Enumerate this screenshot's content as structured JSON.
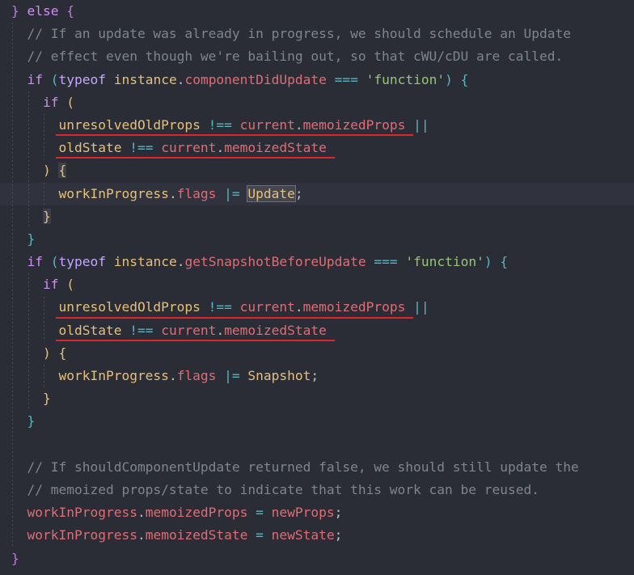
{
  "editor": {
    "lines": [
      [
        {
          "c": "br1",
          "t": "}"
        },
        {
          "c": "pl",
          "t": " "
        },
        {
          "c": "kw",
          "t": "else"
        },
        {
          "c": "pl",
          "t": " "
        },
        {
          "c": "br1",
          "t": "{"
        }
      ],
      [
        {
          "c": "pl",
          "t": "  "
        },
        {
          "c": "cm",
          "t": "// If an update was already in progress, we should schedule an Update"
        }
      ],
      [
        {
          "c": "pl",
          "t": "  "
        },
        {
          "c": "cm",
          "t": "// effect even though we're bailing out, so that cWU/cDU are called."
        }
      ],
      [
        {
          "c": "pl",
          "t": "  "
        },
        {
          "c": "kw",
          "t": "if"
        },
        {
          "c": "pl",
          "t": " "
        },
        {
          "c": "br2",
          "t": "("
        },
        {
          "c": "kw2",
          "t": "typeof"
        },
        {
          "c": "pl",
          "t": " "
        },
        {
          "c": "id",
          "t": "instance"
        },
        {
          "c": "pl",
          "t": "."
        },
        {
          "c": "fn",
          "t": "componentDidUpdate"
        },
        {
          "c": "pl",
          "t": " "
        },
        {
          "c": "op",
          "t": "==="
        },
        {
          "c": "pl",
          "t": " "
        },
        {
          "c": "str",
          "t": "'function'"
        },
        {
          "c": "br2",
          "t": ")"
        },
        {
          "c": "pl",
          "t": " "
        },
        {
          "c": "br2",
          "t": "{"
        }
      ],
      [
        {
          "c": "pl",
          "t": "    "
        },
        {
          "c": "kw",
          "t": "if"
        },
        {
          "c": "pl",
          "t": " "
        },
        {
          "c": "br3",
          "t": "("
        }
      ],
      [
        {
          "c": "pl",
          "t": "      "
        },
        {
          "c": "id",
          "t": "unresolvedOldProps"
        },
        {
          "c": "pl",
          "t": " "
        },
        {
          "c": "op",
          "t": "!=="
        },
        {
          "c": "pl",
          "t": " "
        },
        {
          "c": "fn",
          "t": "current"
        },
        {
          "c": "pl",
          "t": "."
        },
        {
          "c": "fn",
          "t": "memoizedProps"
        },
        {
          "c": "pl",
          "t": " "
        },
        {
          "c": "op",
          "t": "||"
        }
      ],
      [
        {
          "c": "pl",
          "t": "      "
        },
        {
          "c": "id",
          "t": "oldState"
        },
        {
          "c": "pl",
          "t": " "
        },
        {
          "c": "op",
          "t": "!=="
        },
        {
          "c": "pl",
          "t": " "
        },
        {
          "c": "fn",
          "t": "current"
        },
        {
          "c": "pl",
          "t": "."
        },
        {
          "c": "fn",
          "t": "memoizedState"
        }
      ],
      [
        {
          "c": "pl",
          "t": "    "
        },
        {
          "c": "br3",
          "t": ")"
        },
        {
          "c": "pl",
          "t": " "
        },
        {
          "c": "br3 sel",
          "t": "{"
        }
      ],
      [
        {
          "c": "pl",
          "t": "      "
        },
        {
          "c": "id",
          "t": "workInProgress"
        },
        {
          "c": "pl",
          "t": "."
        },
        {
          "c": "fn",
          "t": "flags"
        },
        {
          "c": "pl",
          "t": " "
        },
        {
          "c": "op",
          "t": "|="
        },
        {
          "c": "pl",
          "t": " "
        },
        {
          "c": "id hl",
          "t": "Update"
        },
        {
          "c": "pl",
          "t": ";"
        }
      ],
      [
        {
          "c": "pl",
          "t": "    "
        },
        {
          "c": "br3 sel",
          "t": "}"
        }
      ],
      [
        {
          "c": "pl",
          "t": "  "
        },
        {
          "c": "br2",
          "t": "}"
        }
      ],
      [
        {
          "c": "pl",
          "t": "  "
        },
        {
          "c": "kw",
          "t": "if"
        },
        {
          "c": "pl",
          "t": " "
        },
        {
          "c": "br2",
          "t": "("
        },
        {
          "c": "kw2",
          "t": "typeof"
        },
        {
          "c": "pl",
          "t": " "
        },
        {
          "c": "id",
          "t": "instance"
        },
        {
          "c": "pl",
          "t": "."
        },
        {
          "c": "fn",
          "t": "getSnapshotBeforeUpdate"
        },
        {
          "c": "pl",
          "t": " "
        },
        {
          "c": "op",
          "t": "==="
        },
        {
          "c": "pl",
          "t": " "
        },
        {
          "c": "str",
          "t": "'function'"
        },
        {
          "c": "br2",
          "t": ")"
        },
        {
          "c": "pl",
          "t": " "
        },
        {
          "c": "br2",
          "t": "{"
        }
      ],
      [
        {
          "c": "pl",
          "t": "    "
        },
        {
          "c": "kw",
          "t": "if"
        },
        {
          "c": "pl",
          "t": " "
        },
        {
          "c": "br3",
          "t": "("
        }
      ],
      [
        {
          "c": "pl",
          "t": "      "
        },
        {
          "c": "id",
          "t": "unresolvedOldProps"
        },
        {
          "c": "pl",
          "t": " "
        },
        {
          "c": "op",
          "t": "!=="
        },
        {
          "c": "pl",
          "t": " "
        },
        {
          "c": "fn",
          "t": "current"
        },
        {
          "c": "pl",
          "t": "."
        },
        {
          "c": "fn",
          "t": "memoizedProps"
        },
        {
          "c": "pl",
          "t": " "
        },
        {
          "c": "op",
          "t": "||"
        }
      ],
      [
        {
          "c": "pl",
          "t": "      "
        },
        {
          "c": "id",
          "t": "oldState"
        },
        {
          "c": "pl",
          "t": " "
        },
        {
          "c": "op",
          "t": "!=="
        },
        {
          "c": "pl",
          "t": " "
        },
        {
          "c": "fn",
          "t": "current"
        },
        {
          "c": "pl",
          "t": "."
        },
        {
          "c": "fn",
          "t": "memoizedState"
        }
      ],
      [
        {
          "c": "pl",
          "t": "    "
        },
        {
          "c": "br3",
          "t": ")"
        },
        {
          "c": "pl",
          "t": " "
        },
        {
          "c": "br3",
          "t": "{"
        }
      ],
      [
        {
          "c": "pl",
          "t": "      "
        },
        {
          "c": "id",
          "t": "workInProgress"
        },
        {
          "c": "pl",
          "t": "."
        },
        {
          "c": "fn",
          "t": "flags"
        },
        {
          "c": "pl",
          "t": " "
        },
        {
          "c": "op",
          "t": "|="
        },
        {
          "c": "pl",
          "t": " "
        },
        {
          "c": "id",
          "t": "Snapshot"
        },
        {
          "c": "pl",
          "t": ";"
        }
      ],
      [
        {
          "c": "pl",
          "t": "    "
        },
        {
          "c": "br3",
          "t": "}"
        }
      ],
      [
        {
          "c": "pl",
          "t": "  "
        },
        {
          "c": "br2",
          "t": "}"
        }
      ],
      [
        {
          "c": "pl",
          "t": ""
        }
      ],
      [
        {
          "c": "pl",
          "t": "  "
        },
        {
          "c": "cm",
          "t": "// If shouldComponentUpdate returned false, we should still update the"
        }
      ],
      [
        {
          "c": "pl",
          "t": "  "
        },
        {
          "c": "cm",
          "t": "// memoized props/state to indicate that this work can be reused."
        }
      ],
      [
        {
          "c": "pl",
          "t": "  "
        },
        {
          "c": "fn",
          "t": "workInProgress"
        },
        {
          "c": "pl",
          "t": "."
        },
        {
          "c": "fn",
          "t": "memoizedProps"
        },
        {
          "c": "pl",
          "t": " "
        },
        {
          "c": "op",
          "t": "="
        },
        {
          "c": "pl",
          "t": " "
        },
        {
          "c": "fn",
          "t": "newProps"
        },
        {
          "c": "pl",
          "t": ";"
        }
      ],
      [
        {
          "c": "pl",
          "t": "  "
        },
        {
          "c": "fn",
          "t": "workInProgress"
        },
        {
          "c": "pl",
          "t": "."
        },
        {
          "c": "fn",
          "t": "memoizedState"
        },
        {
          "c": "pl",
          "t": " "
        },
        {
          "c": "op",
          "t": "="
        },
        {
          "c": "pl",
          "t": " "
        },
        {
          "c": "fn",
          "t": "newState"
        },
        {
          "c": "pl",
          "t": ";"
        }
      ],
      [
        {
          "c": "br1",
          "t": "}"
        }
      ]
    ],
    "current_line": 8,
    "underlined_lines": [
      5,
      6,
      13,
      14
    ]
  }
}
